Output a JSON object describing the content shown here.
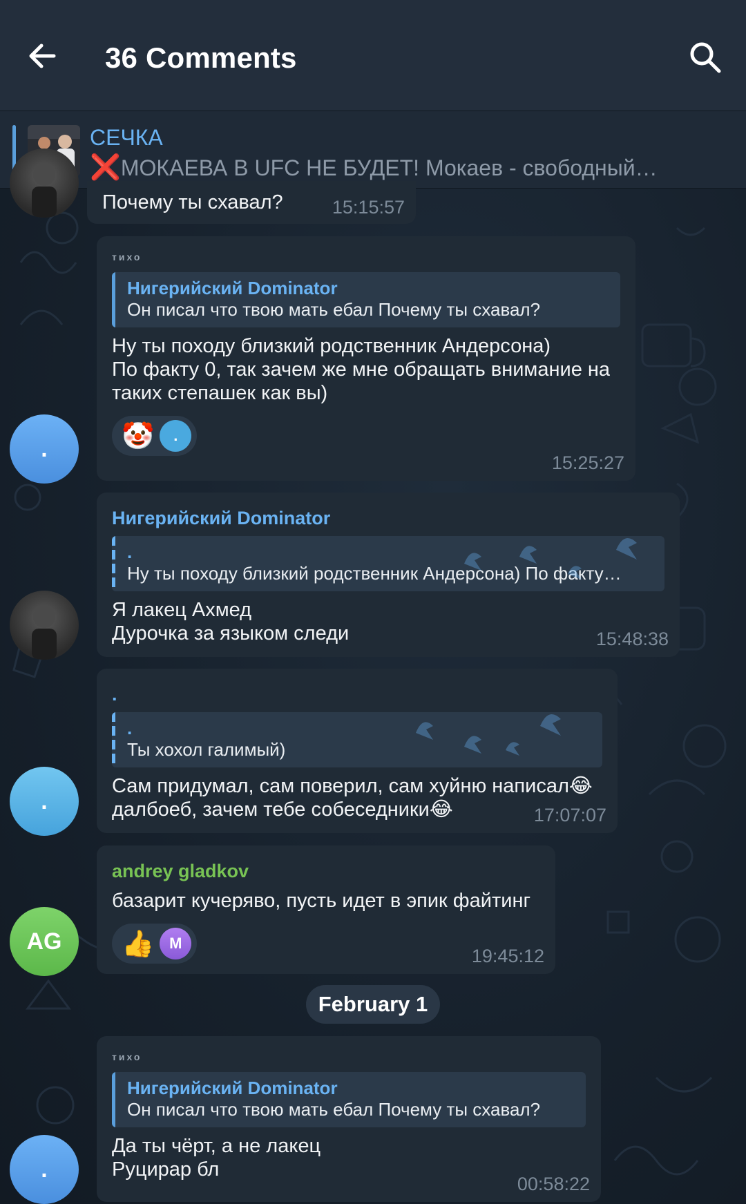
{
  "header": {
    "title": "36 Comments",
    "back_icon": "arrow-left-icon",
    "search_icon": "search-icon"
  },
  "post": {
    "channel": "СЕЧКА",
    "mark": "❌",
    "excerpt": "МОКАЕВА В UFC НЕ БУДЕТ!  Мокаев - свободный…"
  },
  "messages": [
    {
      "text": "Почему ты схавал?",
      "time": "15:15:57"
    },
    {
      "sender": "тихо",
      "reply_name": "Нигерийский Dominator",
      "reply_text": "Он писал что твою мать ебал  Почему ты схавал?",
      "text_lines": [
        "Ну ты походу близкий родственник Андерсона)",
        "По факту 0, так зачем же мне обращать внимание на",
        "таких степашек как вы)"
      ],
      "reaction": "🤡",
      "time": "15:25:27"
    },
    {
      "sender": "Нигерийский Dominator",
      "reply_name": ".",
      "reply_text": "Ну ты походу близкий родственник Андерсона) По факту…",
      "text_lines": [
        "Я лакец Ахмед",
        "Дурочка за языком следи"
      ],
      "time": "15:48:38"
    },
    {
      "sender": ".",
      "reply_name": ".",
      "reply_text": "Ты хохол галимый)",
      "text_lines": [
        "Сам придумал, сам поверил, сам хуйню написал😂",
        "далбоеб, зачем тебе собеседники😂"
      ],
      "time": "17:07:07"
    },
    {
      "sender": "andrey gladkov",
      "text_lines": [
        "базарит кучеряво, пусть идет в эпик файтинг"
      ],
      "reaction": "👍",
      "reaction_avatar": "M",
      "time": "19:45:12",
      "avatar_initials": "AG"
    },
    {
      "sender": "тихо",
      "reply_name": "Нигерийский Dominator",
      "reply_text": "Он писал что твою мать ебал  Почему ты схавал?",
      "text_lines": [
        "Да ты чёрт, а не лакец",
        "Руцирар бл"
      ],
      "time": "00:58:22"
    }
  ],
  "date_separator": "February 1",
  "avatar_dot": ".",
  "colors": {
    "header_bg": "#232e3c",
    "bubble_bg": "#202b36",
    "accent": "#6ab3f3",
    "green_name": "#78c354"
  }
}
